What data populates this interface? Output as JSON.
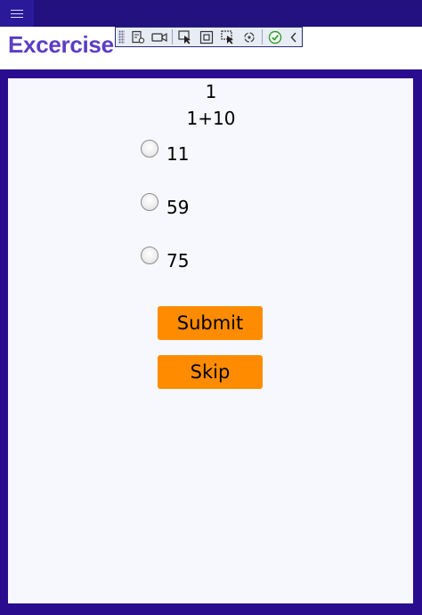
{
  "app": {
    "title": "Excercise"
  },
  "question": {
    "number": "1",
    "text": "1+10"
  },
  "options": [
    {
      "label": "11",
      "selected": false
    },
    {
      "label": "59",
      "selected": false
    },
    {
      "label": "75",
      "selected": false
    }
  ],
  "actions": {
    "submit_label": "Submit",
    "skip_label": "Skip"
  },
  "devtoolbar": {
    "icons": [
      "live-visual-tree-icon",
      "record-icon",
      "select-element-icon",
      "display-layout-adorners-icon",
      "track-focus-icon",
      "hot-reload-icon",
      "checkmark-icon",
      "collapse-chevron-icon"
    ]
  },
  "colors": {
    "frame": "#2a0d8e",
    "title": "#5b3cc4",
    "button": "#ff8c00",
    "card": "#f7f8fd"
  }
}
